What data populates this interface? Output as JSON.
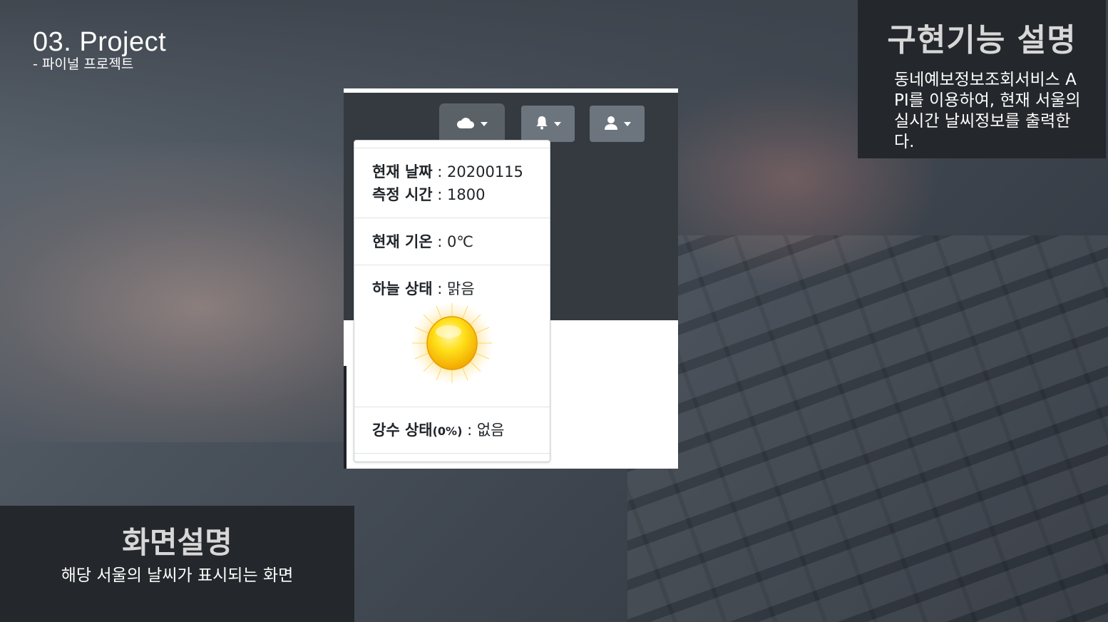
{
  "slide": {
    "title": "03. Project",
    "subtitle": "- 파이널 프로젝트"
  },
  "feature_panel": {
    "title": "구현기능 설명",
    "description": "동네예보정보조회서비스 API를 이용하여, 현재 서울의 실시간 날씨정보를 출력한다."
  },
  "screen_panel": {
    "title": "화면설명",
    "description": "해당 서울의 날씨가 표시되는 화면"
  },
  "navbar": {
    "buttons": [
      {
        "icon": "cloud-icon",
        "active": true
      },
      {
        "icon": "bell-icon",
        "active": false
      },
      {
        "icon": "user-icon",
        "active": false
      }
    ]
  },
  "weather_dropdown": {
    "date_label": "현재 날짜",
    "date_value": "20200115",
    "time_label": "측정 시간",
    "time_value": "1800",
    "temp_label": "현재 기온",
    "temp_value": "0℃",
    "sky_label": "하늘 상태",
    "sky_value": "맑음",
    "sky_icon": "sun-icon",
    "rain_label": "강수 상태",
    "rain_pct": "(0%)",
    "rain_value": "없음",
    "separator": " : "
  },
  "colors": {
    "panel_bg": "#24272b",
    "navbar_bg": "#343a40",
    "button_bg": "#6c757d"
  }
}
